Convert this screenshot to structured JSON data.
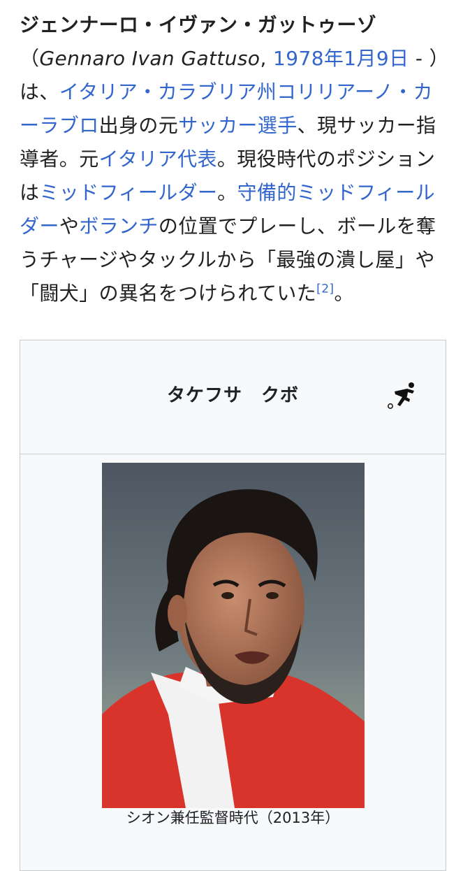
{
  "article": {
    "name": "ジェンナーロ・イヴァン・ガットゥーゾ",
    "open_paren": "（",
    "latin_name": "Gennaro Ivan Gattuso",
    "comma": ", ",
    "birth_date": "1978年1月9日",
    "date_suffix": " - ）は、",
    "birthplace": "イタリア・カラブリア州コリリアーノ・カーラブロ",
    "t1": "出身の元",
    "footballer": "サッカー選手",
    "t2": "、現サッカー指導者。元",
    "national_team": "イタリア代表",
    "t3": "。現役時代のポジションは",
    "midfielder": "ミッドフィールダー",
    "t4": "。",
    "defensive_midfielder": "守備的ミッドフィールダー",
    "t5": "や",
    "volante": "ボランチ",
    "t6": "の位置でプレーし、ボールを奪うチャージやタックルから「最強の潰し屋」や「闘犬」の異名をつけられていた",
    "reference": "[2]",
    "t7": "。"
  },
  "infobox": {
    "title": "タケフサ　クボ",
    "icon": "soccer-player-icon",
    "photo_alt": "portrait photo",
    "caption": "シオン兼任監督時代（2013年）"
  },
  "colors": {
    "link": "#3366cc",
    "text": "#202122",
    "infobox_bg": "#f8f9fa",
    "infobox_border": "#c8ccd1"
  }
}
